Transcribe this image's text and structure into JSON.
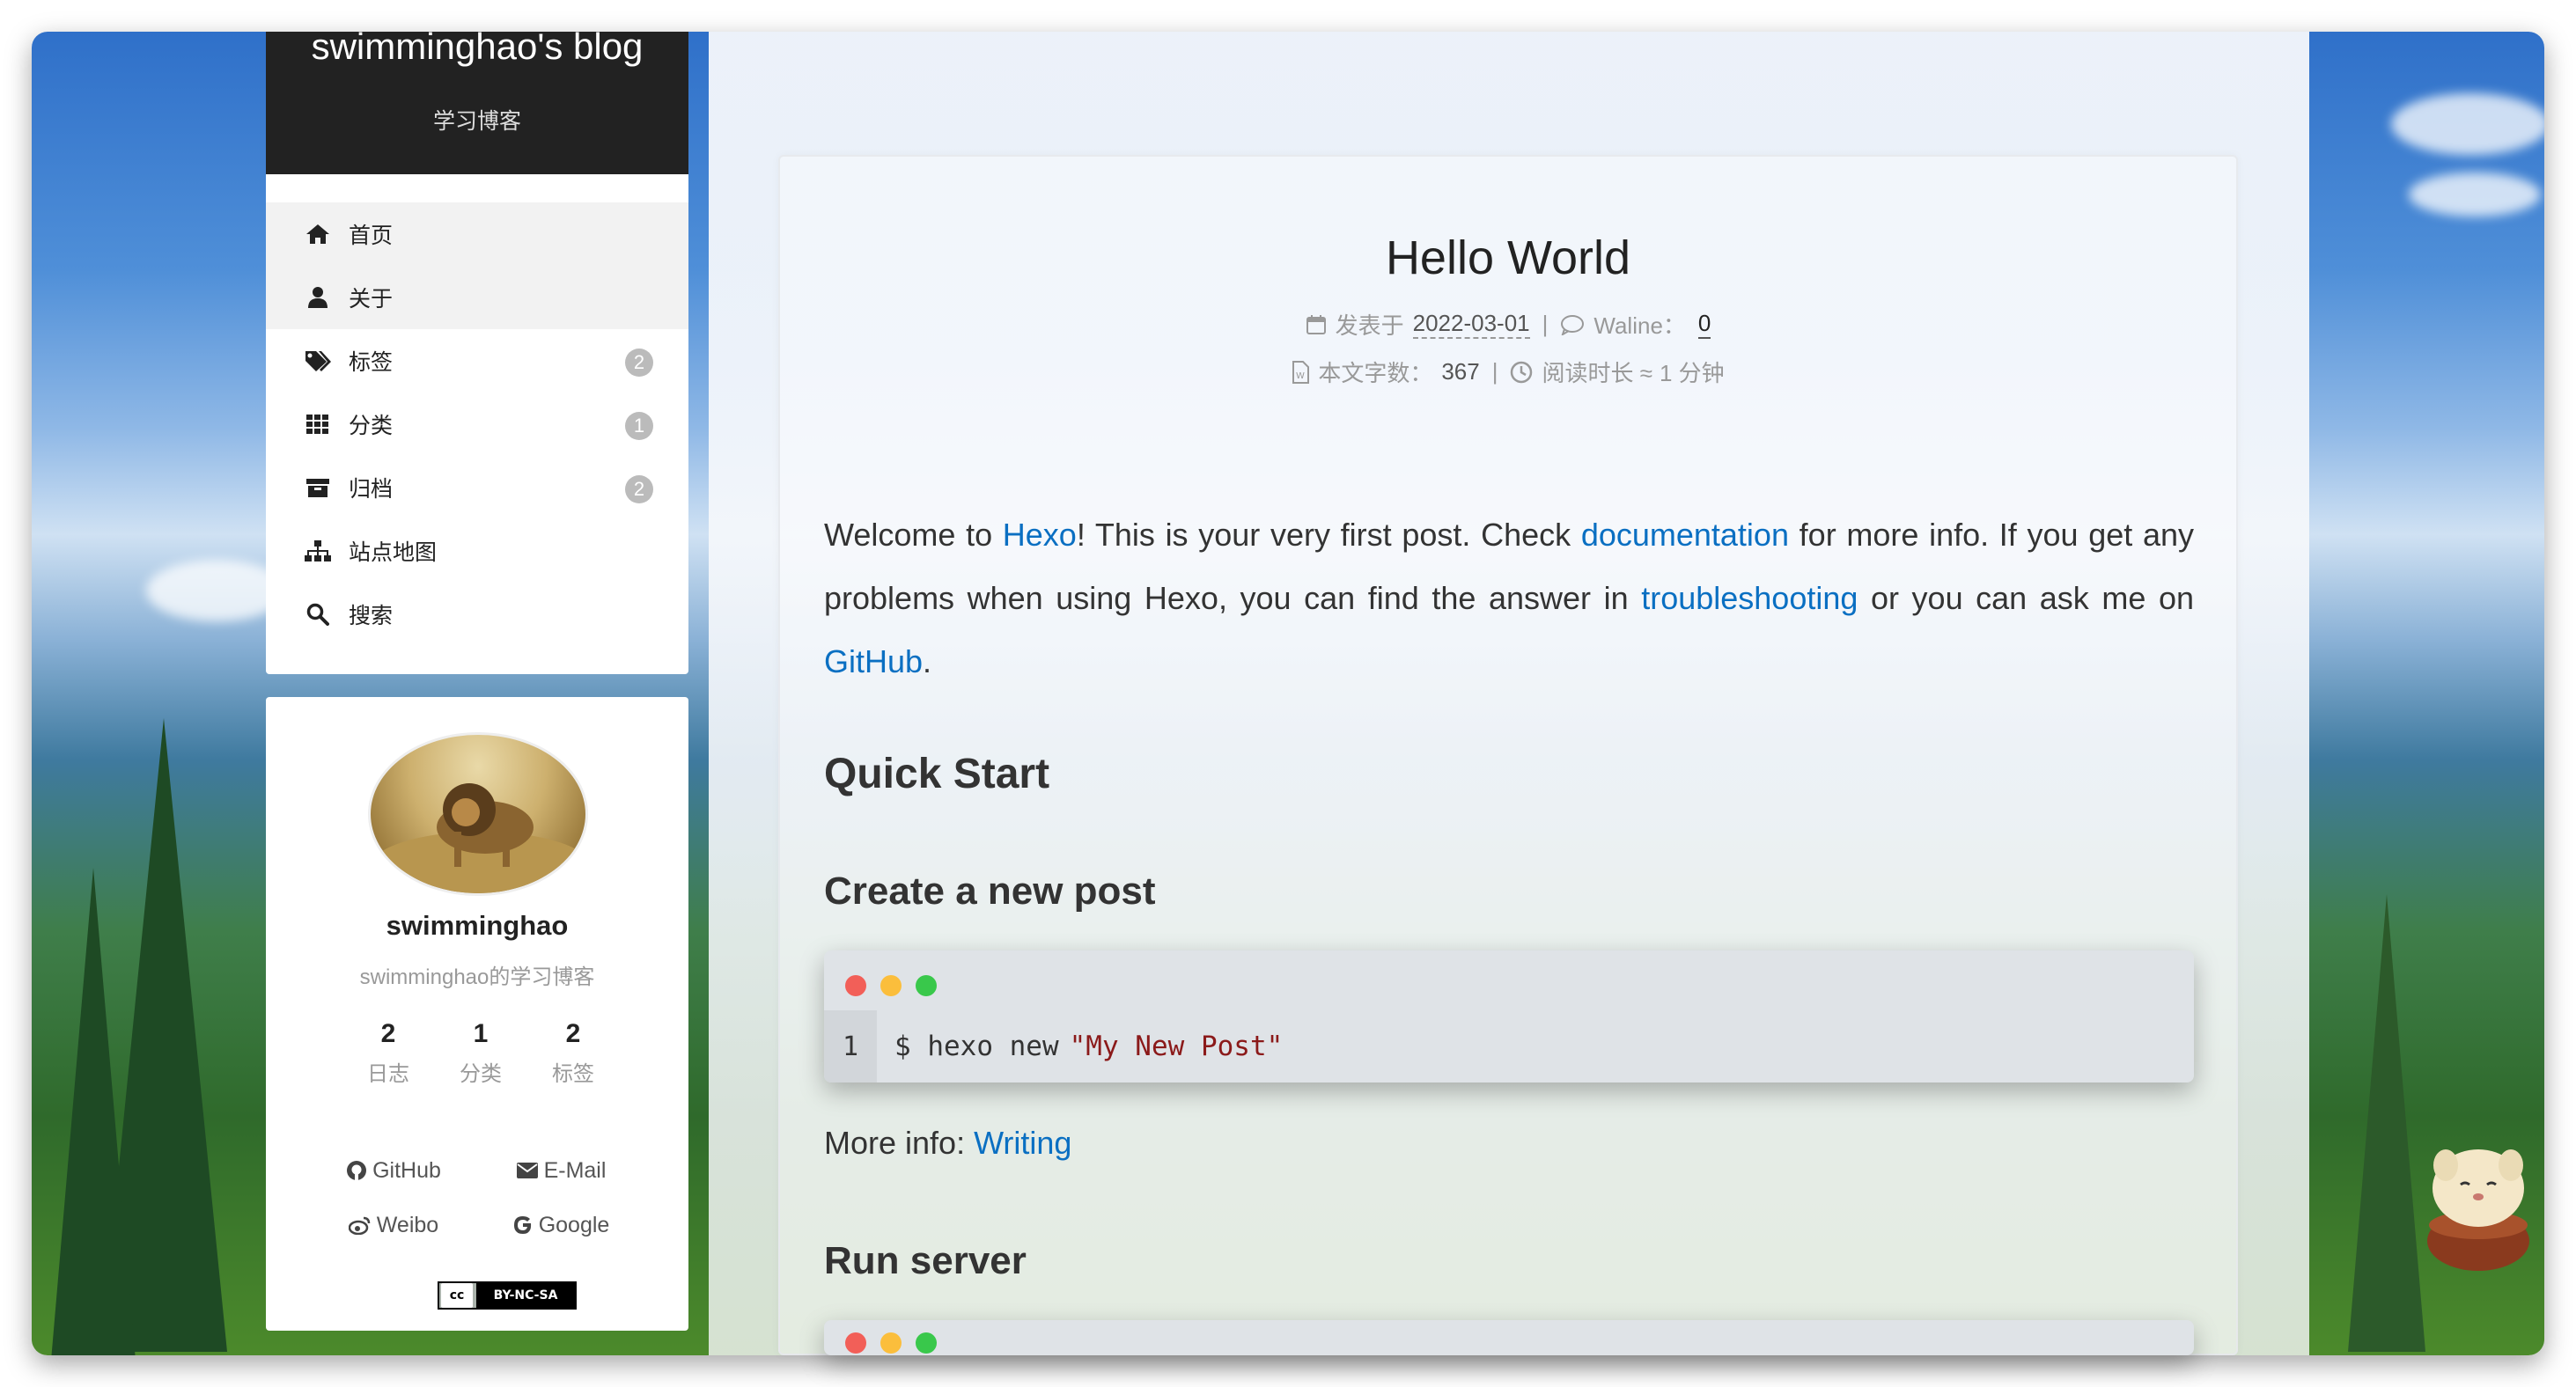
{
  "site": {
    "title": "swimminghao's blog",
    "subtitle": "学习博客"
  },
  "menu": {
    "items": [
      {
        "label": "首页",
        "icon": "home-icon",
        "badge": null,
        "active": true
      },
      {
        "label": "关于",
        "icon": "user-icon",
        "badge": null,
        "active": true
      },
      {
        "label": "标签",
        "icon": "tags-icon",
        "badge": "2"
      },
      {
        "label": "分类",
        "icon": "grid-icon",
        "badge": "1"
      },
      {
        "label": "归档",
        "icon": "archive-icon",
        "badge": "2"
      },
      {
        "label": "站点地图",
        "icon": "sitemap-icon",
        "badge": null
      },
      {
        "label": "搜索",
        "icon": "search-icon",
        "badge": null
      }
    ]
  },
  "author": {
    "name": "swimminghao",
    "description": "swimminghao的学习博客",
    "stats": [
      {
        "count": "2",
        "label": "日志"
      },
      {
        "count": "1",
        "label": "分类"
      },
      {
        "count": "2",
        "label": "标签"
      }
    ],
    "links": [
      {
        "label": "GitHub",
        "icon": "github-icon"
      },
      {
        "label": "E-Mail",
        "icon": "envelope-icon"
      },
      {
        "label": "Weibo",
        "icon": "weibo-icon"
      },
      {
        "label": "Google",
        "icon": "google-icon"
      }
    ],
    "license": "BY-NC-SA",
    "license_logo": "cc"
  },
  "post": {
    "title": "Hello World",
    "meta": {
      "posted_label": "发表于",
      "posted_date": "2022-03-01",
      "comments_label": "Waline：",
      "comments_count": "0",
      "words_label": "本文字数：",
      "words_count": "367",
      "reading_label": "阅读时长 ≈",
      "reading_value": "1 分钟"
    },
    "intro": {
      "p1": "Welcome to ",
      "link_hexo": "Hexo",
      "p2": "! This is your very first post. Check ",
      "link_docs": "documentation",
      "p3": " for more info. If you get any problems when using Hexo, you can find the answer in ",
      "link_trouble": "troubleshooting",
      "p4": " or you can ask me on ",
      "link_github": "GitHub",
      "p5": "."
    },
    "h_quick_start": "Quick Start",
    "h_create_post": "Create a new post",
    "code1": {
      "line_no": "1",
      "cmd": "$ hexo new",
      "str": "\"My New Post\""
    },
    "more_info_label": "More info: ",
    "more_info_link": "Writing",
    "h_run_server": "Run server"
  },
  "colors": {
    "link": "#0a6fc2",
    "dot_red": "#f25f58",
    "dot_yellow": "#fbbe3c",
    "dot_green": "#39c84b",
    "brand_bg": "#222222"
  }
}
